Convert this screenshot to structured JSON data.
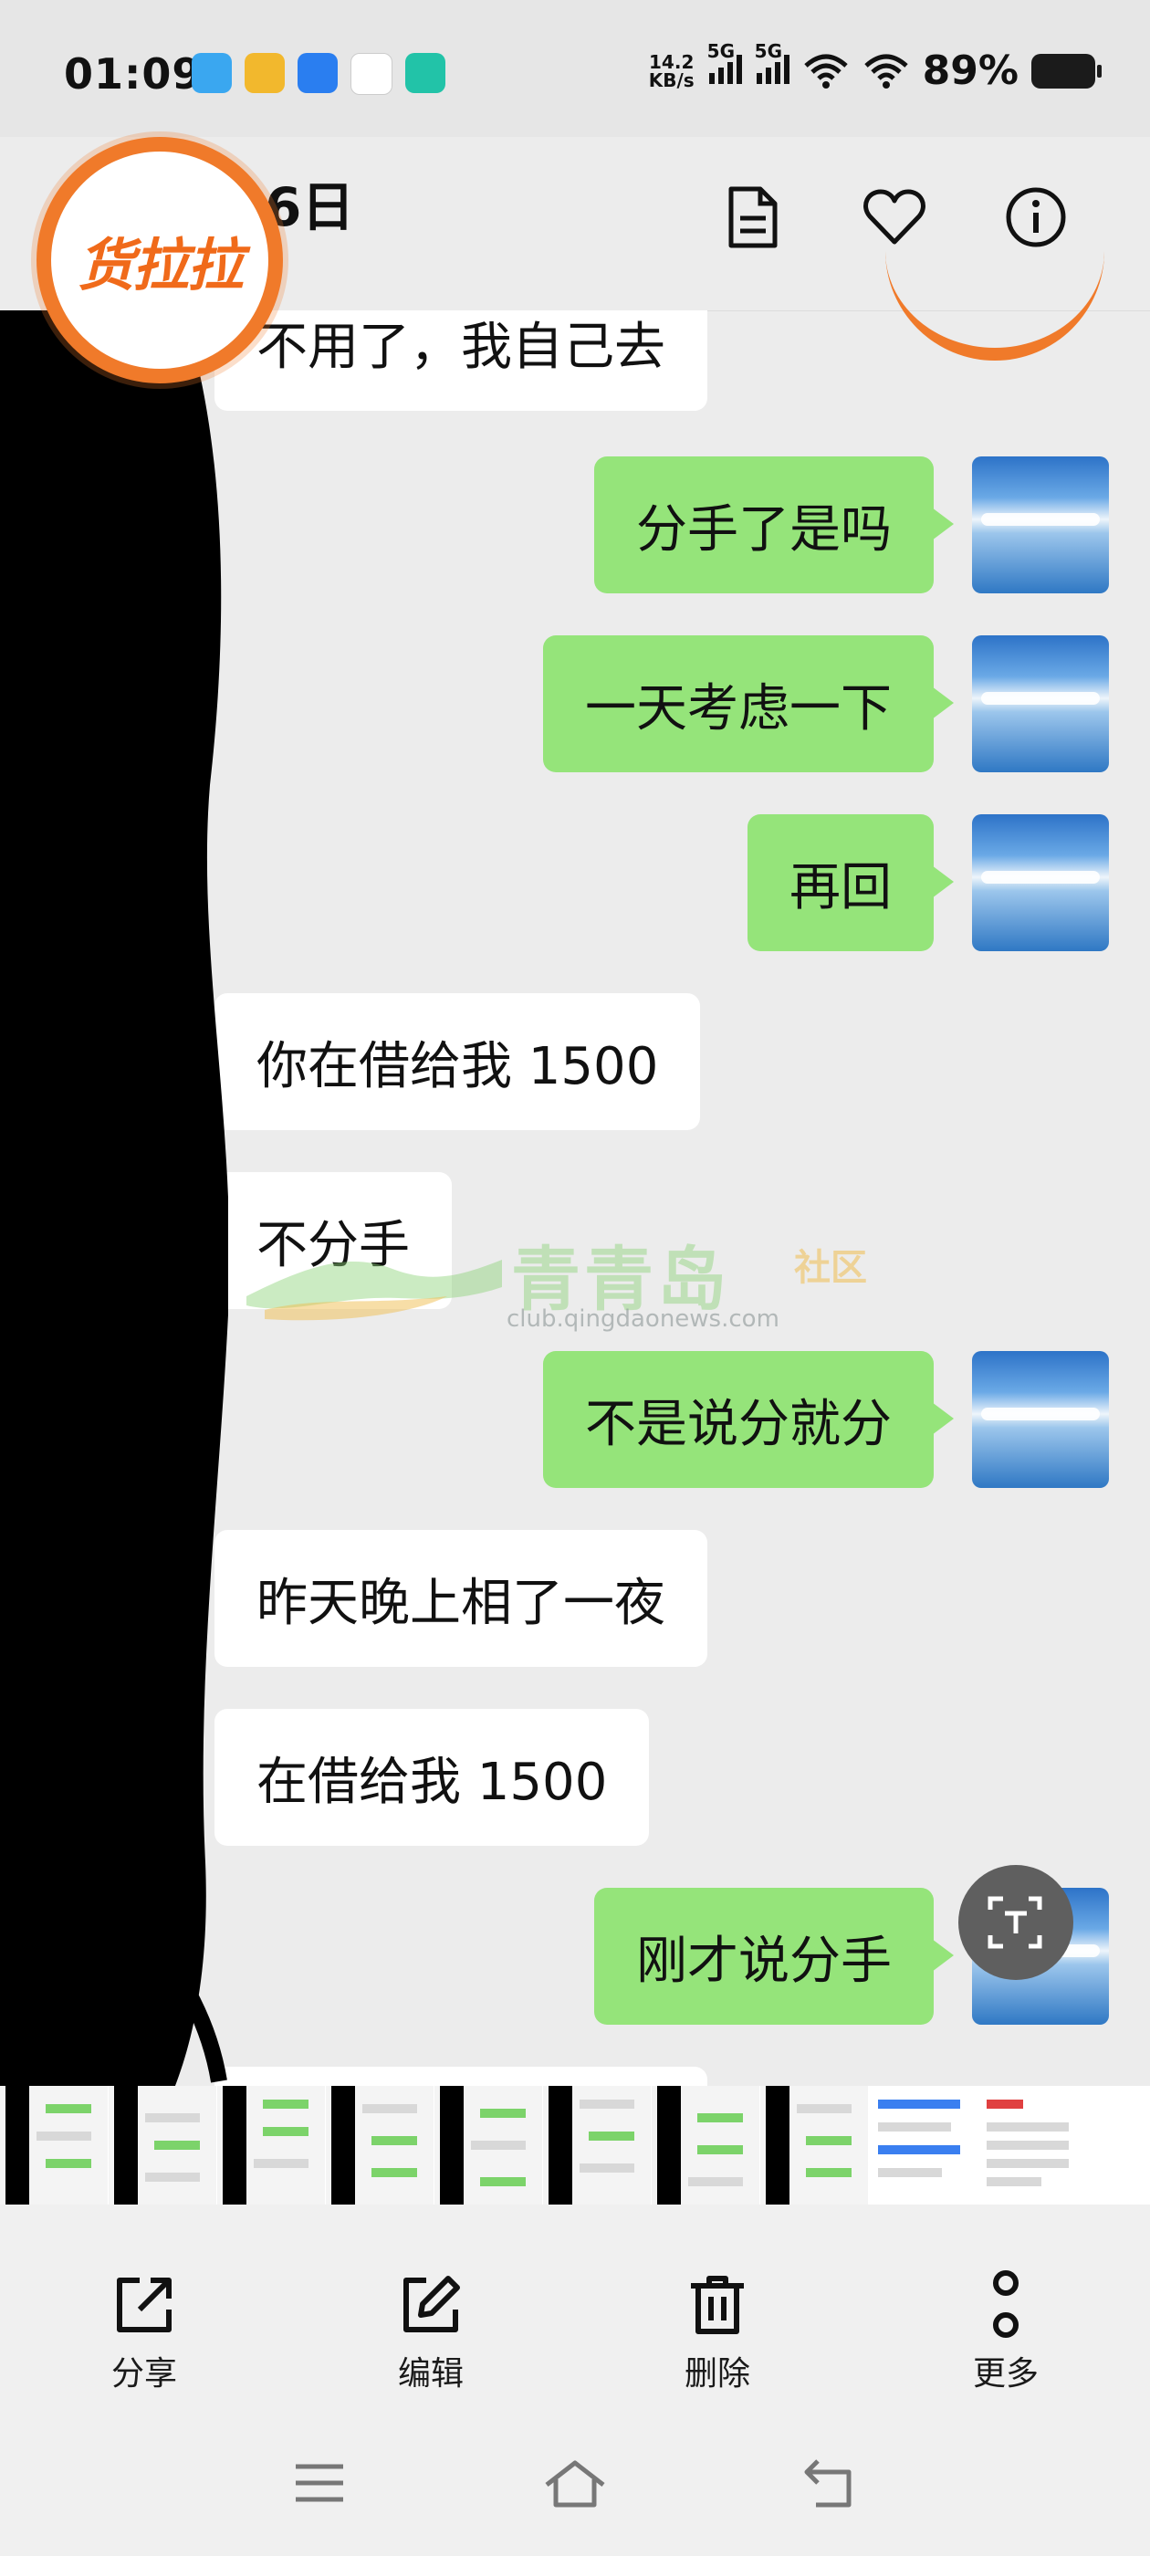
{
  "status": {
    "time": "01:09",
    "speed_top": "14.2",
    "speed_bottom": "KB/s",
    "net1": "5G",
    "net2": "5G",
    "battery": "89%",
    "app_colors": [
      "#3aa7f0",
      "#f2b82d",
      "#2a7ef0",
      "#ffffff",
      "#22c3a8"
    ]
  },
  "header": {
    "title": "6日",
    "icons": [
      "document-icon",
      "heart-icon",
      "info-icon"
    ]
  },
  "overlay": {
    "logo_text": "货拉拉",
    "logo_color": "#f06a1a"
  },
  "messages": [
    {
      "side": "in",
      "text": "不用了，我自己去"
    },
    {
      "side": "out",
      "text": "分手了是吗"
    },
    {
      "side": "out",
      "text": "一天考虑一下"
    },
    {
      "side": "out",
      "text": "再回"
    },
    {
      "side": "in",
      "text": "你在借给我 1500"
    },
    {
      "side": "in",
      "text": "不分手"
    },
    {
      "side": "out",
      "text": "不是说分就分"
    },
    {
      "side": "in",
      "text": "昨天晚上相了一夜"
    },
    {
      "side": "in",
      "text": "在借给我 1500"
    },
    {
      "side": "out",
      "text": "刚才说分手"
    }
  ],
  "watermark": {
    "main": "青青岛",
    "sub": "社区",
    "url": "club.qingdaonews.com"
  },
  "toolbar": {
    "share": "分享",
    "edit": "编辑",
    "delete": "删除",
    "more": "更多"
  },
  "colors": {
    "outgoing_bubble": "#95e47a",
    "incoming_bubble": "#ffffff",
    "background": "#ececec"
  }
}
